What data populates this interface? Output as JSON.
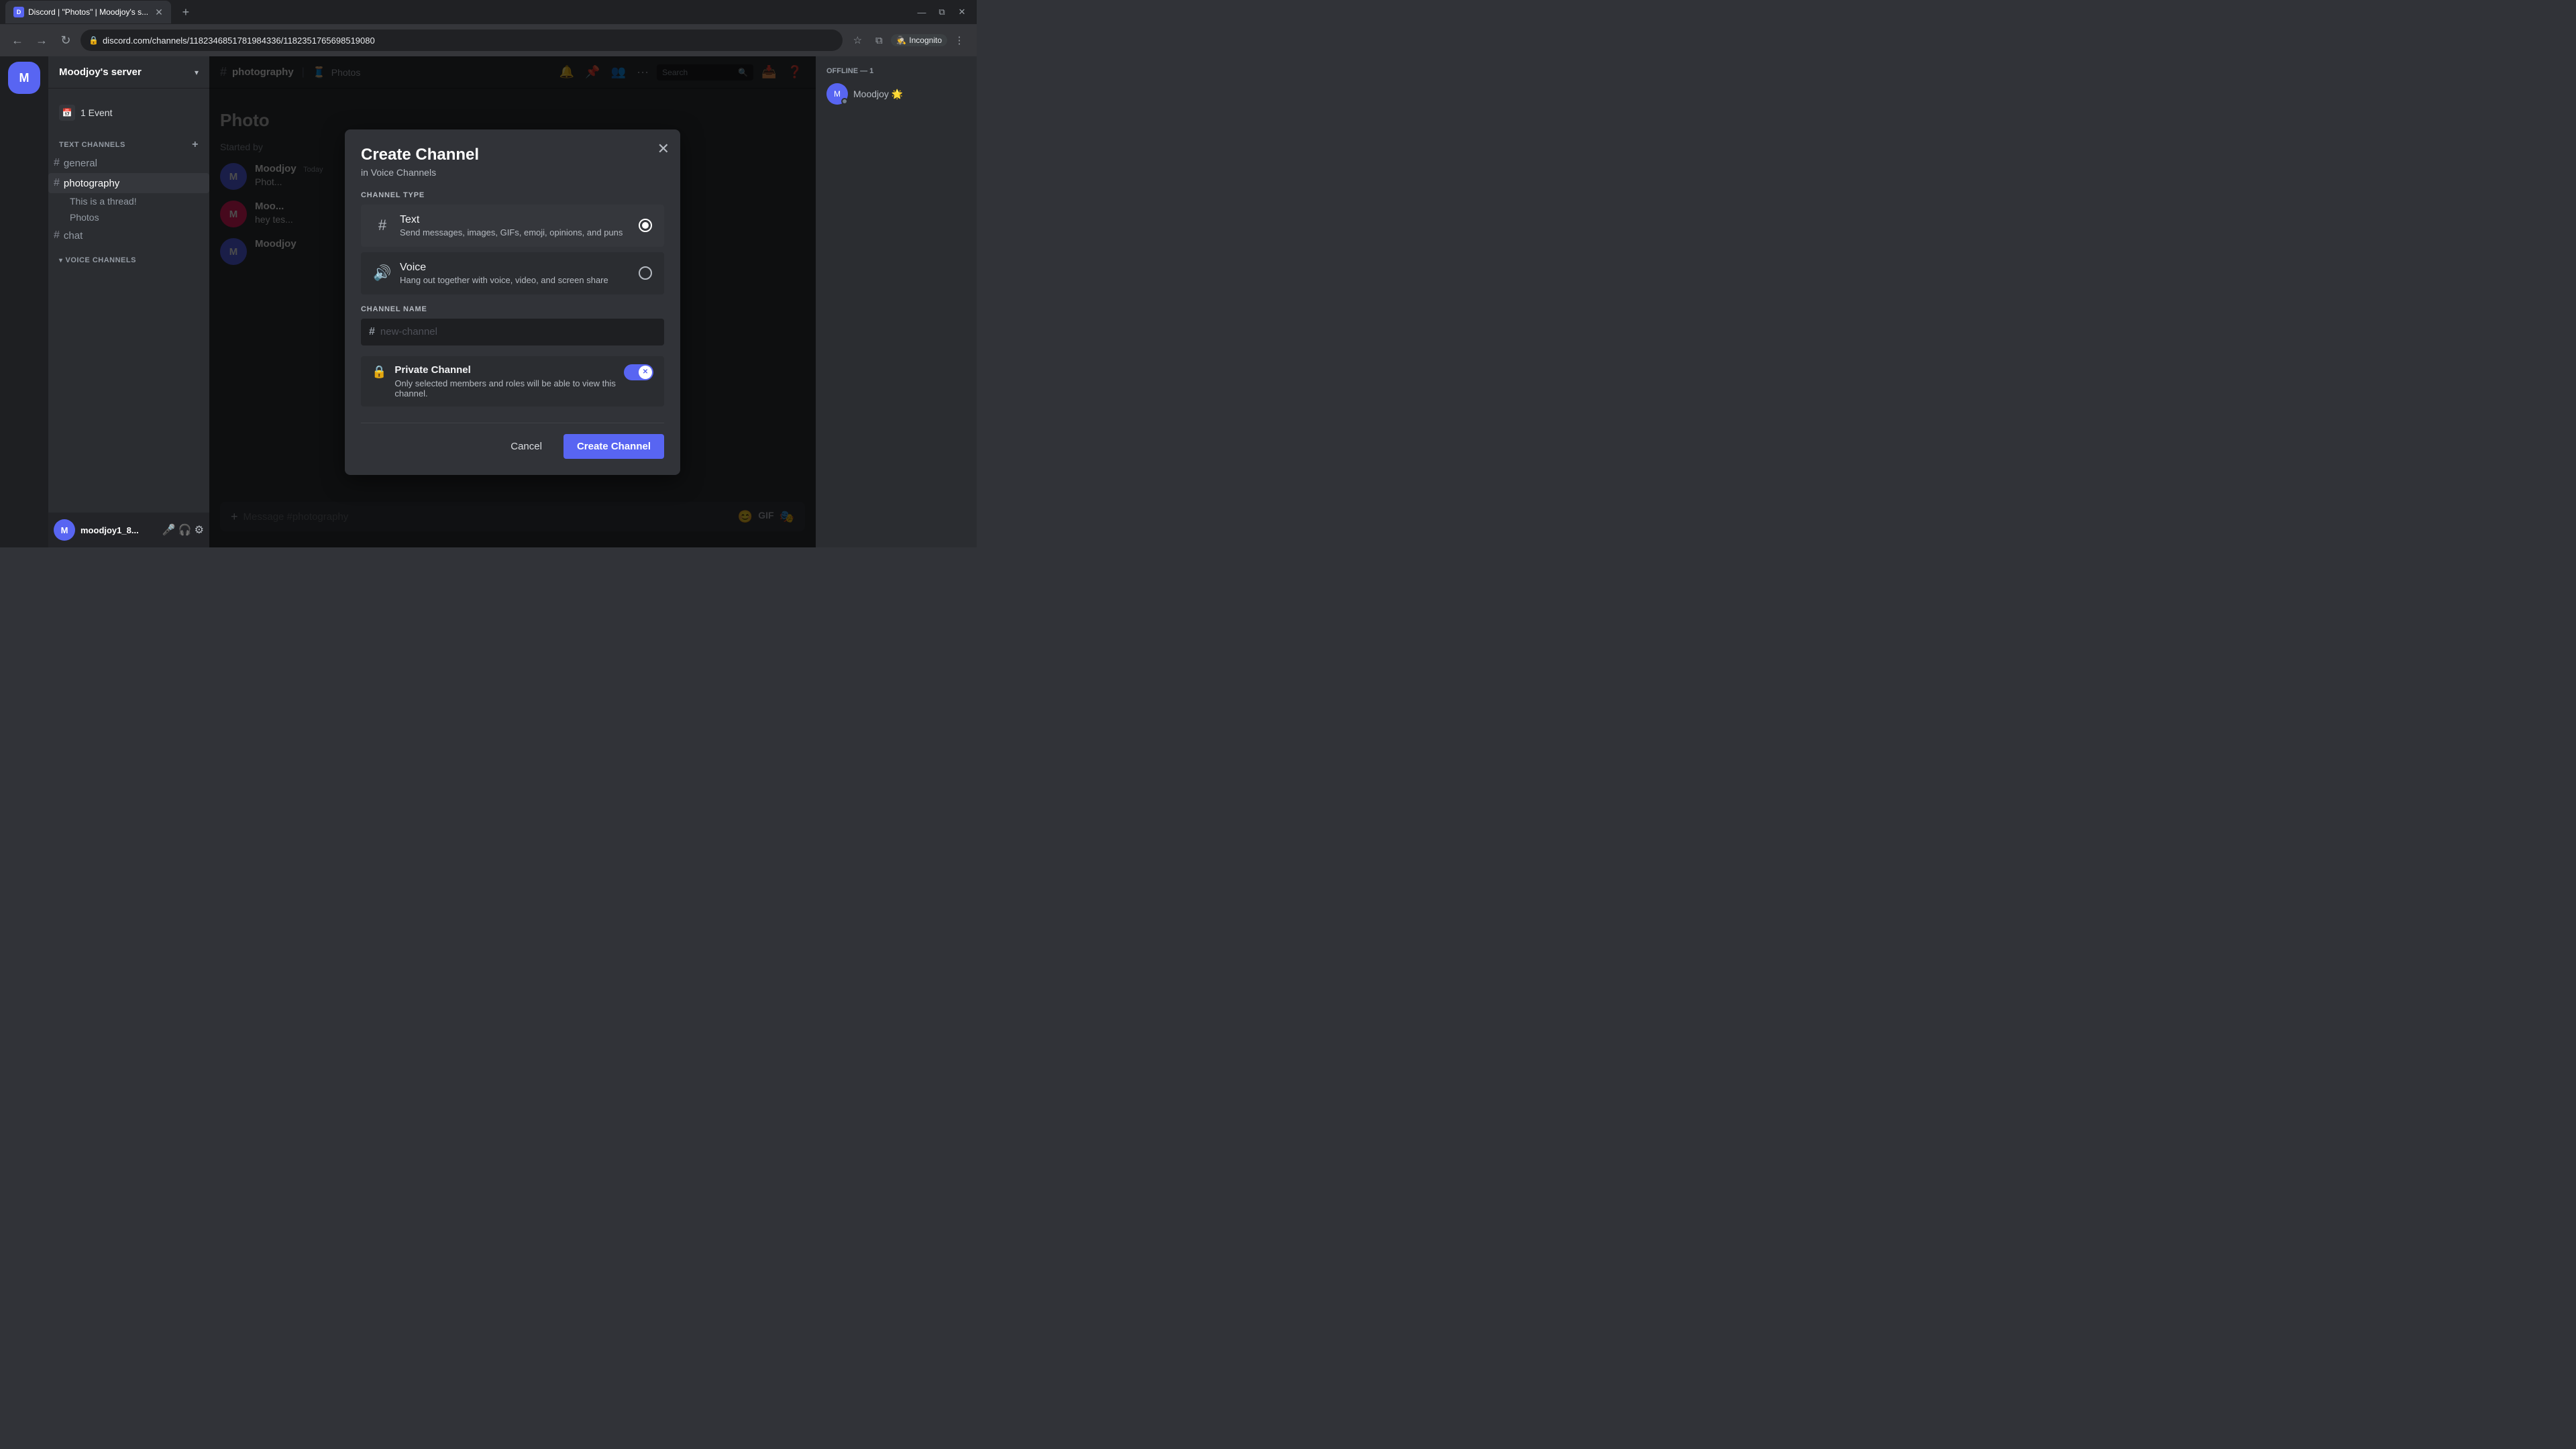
{
  "browser": {
    "tab_title": "Discord | \"Photos\" | Moodjoy's s...",
    "url": "discord.com/channels/1182346851781984336/1182351765698519080",
    "incognito_label": "Incognito"
  },
  "discord": {
    "server_name": "Moodjoy's server",
    "server_initial": "M",
    "channel_header": {
      "channel_icon": "#",
      "channel_name": "photography",
      "breadcrumb_divider": ">",
      "sub_channel": "Photos",
      "search_placeholder": "Search"
    },
    "sidebar": {
      "text_channels_label": "TEXT CHANNELS",
      "voice_channels_label": "VOICE CHANNELS",
      "channels": [
        {
          "name": "general",
          "type": "text"
        },
        {
          "name": "photography",
          "type": "text",
          "active": true
        },
        {
          "name": "chat",
          "type": "text"
        }
      ],
      "threads": [
        {
          "name": "This is a thread!"
        },
        {
          "name": "Photos"
        }
      ],
      "events": [
        {
          "name": "1 Event"
        }
      ]
    },
    "messages": [
      {
        "author": "Moodjoy",
        "avatar_initial": "M",
        "time": "Today",
        "text": "Phot..."
      },
      {
        "author": "Moo...",
        "avatar_initial": "M",
        "time": "",
        "text": "hey\ntes..."
      },
      {
        "author": "Moodjoy",
        "avatar_initial": "M",
        "time": "",
        "text": ""
      }
    ],
    "channel_title": "Photo",
    "channel_started_by": "Started by",
    "right_sidebar": {
      "offline_label": "OFFLINE — 1",
      "users": [
        {
          "name": "Moodjoy 🌟",
          "initial": "M"
        }
      ]
    },
    "user_area": {
      "name": "moodjoy1_8...",
      "initial": "M"
    }
  },
  "modal": {
    "title": "Create Channel",
    "subtitle": "in Voice Channels",
    "close_label": "✕",
    "channel_type_label": "CHANNEL TYPE",
    "types": [
      {
        "name": "Text",
        "desc": "Send messages, images, GIFs, emoji, opinions, and puns",
        "icon": "#",
        "selected": true
      },
      {
        "name": "Voice",
        "desc": "Hang out together with voice, video, and screen share",
        "icon": "🔊",
        "selected": false
      }
    ],
    "channel_name_label": "CHANNEL NAME",
    "channel_name_placeholder": "new-channel",
    "channel_name_hash": "#",
    "private_channel": {
      "title": "Private Channel",
      "desc": "Only selected members and roles will be able to view this channel.",
      "enabled": true
    },
    "cancel_label": "Cancel",
    "create_label": "Create Channel"
  }
}
